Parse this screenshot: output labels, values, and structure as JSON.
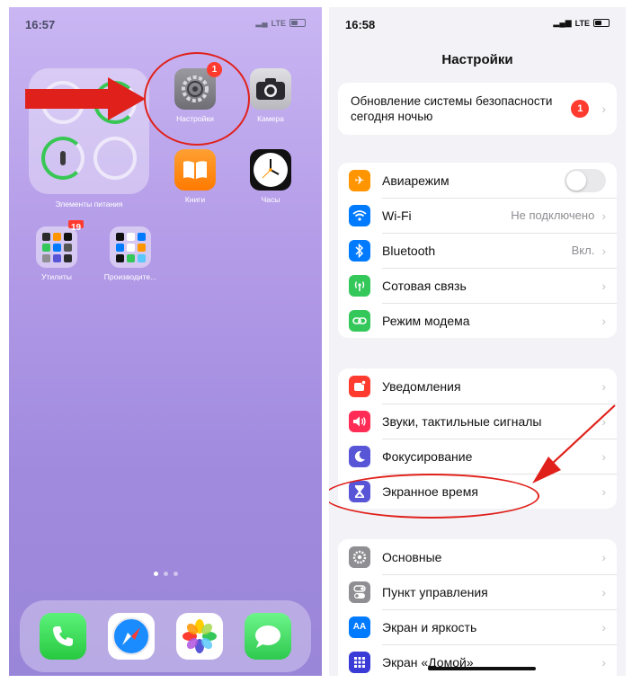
{
  "home_screen": {
    "status": {
      "time": "16:57",
      "network": "LTE"
    },
    "widget": {
      "label": "Элементы питания"
    },
    "apps": [
      {
        "id": "settings",
        "label": "Настройки",
        "badge": "1"
      },
      {
        "id": "camera",
        "label": "Камера"
      },
      {
        "id": "books",
        "label": "Книги"
      },
      {
        "id": "clock",
        "label": "Часы"
      }
    ],
    "folders": [
      {
        "id": "utilities",
        "label": "Утилиты",
        "badge": "19"
      },
      {
        "id": "productivity",
        "label": "Производите..."
      }
    ],
    "dock": [
      {
        "id": "phone",
        "icon": "phone-icon"
      },
      {
        "id": "safari",
        "icon": "compass-icon"
      },
      {
        "id": "photos",
        "icon": "photos-icon"
      },
      {
        "id": "messages",
        "icon": "speech-bubble-icon"
      }
    ]
  },
  "settings_screen": {
    "status": {
      "time": "16:58",
      "network": "LTE"
    },
    "title": "Настройки",
    "update_banner": {
      "label": "Обновление системы безопасности сегодня ночью",
      "badge": "1"
    },
    "group1": [
      {
        "label": "Авиарежим",
        "icon": "airplane-icon",
        "color": "#ff9500",
        "toggle": false
      },
      {
        "label": "Wi-Fi",
        "icon": "wifi-icon",
        "color": "#007aff",
        "value": "Не подключено"
      },
      {
        "label": "Bluetooth",
        "icon": "bluetooth-icon",
        "color": "#007aff",
        "value": "Вкл."
      },
      {
        "label": "Сотовая связь",
        "icon": "antenna-icon",
        "color": "#34c759"
      },
      {
        "label": "Режим модема",
        "icon": "link-icon",
        "color": "#34c759"
      }
    ],
    "group2": [
      {
        "label": "Уведомления",
        "icon": "bell-icon",
        "color": "#ff3b30"
      },
      {
        "label": "Звуки, тактильные сигналы",
        "icon": "speaker-icon",
        "color": "#ff2d55"
      },
      {
        "label": "Фокусирование",
        "icon": "moon-icon",
        "color": "#5856d6"
      },
      {
        "label": "Экранное время",
        "icon": "hourglass-icon",
        "color": "#5856d6"
      }
    ],
    "group3": [
      {
        "label": "Основные",
        "icon": "gear-icon",
        "color": "#8e8e93"
      },
      {
        "label": "Пункт управления",
        "icon": "switches-icon",
        "color": "#8e8e93"
      },
      {
        "label": "Экран и яркость",
        "icon": "text-size-icon",
        "color": "#007aff"
      },
      {
        "label": "Экран «Домой»",
        "icon": "app-grid-icon",
        "color": "#3a3ad6"
      }
    ]
  },
  "colors": {
    "annotation_red": "#e0211b",
    "badge_red": "#ff3b30"
  }
}
